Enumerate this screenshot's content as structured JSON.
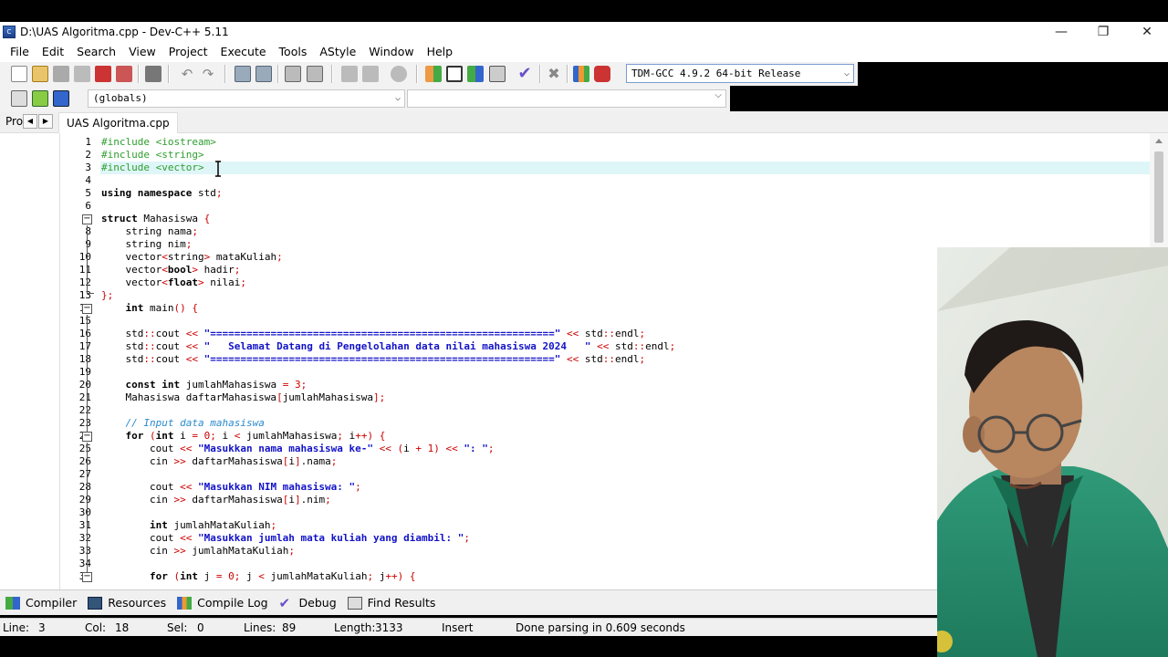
{
  "window": {
    "title": "D:\\UAS Algoritma.cpp - Dev-C++ 5.11",
    "minimize": "—",
    "restore": "❐",
    "close": "✕"
  },
  "menu": [
    "File",
    "Edit",
    "Search",
    "View",
    "Project",
    "Execute",
    "Tools",
    "AStyle",
    "Window",
    "Help"
  ],
  "toolbar": {
    "compiler": "TDM-GCC 4.9.2 64-bit Release",
    "scope": "(globals)",
    "member": ""
  },
  "tabs": {
    "project_tab": "Pro",
    "file_tab": "UAS Algoritma.cpp"
  },
  "editor": {
    "lines": [
      {
        "n": "1",
        "t": "#include <iostream>"
      },
      {
        "n": "2",
        "t": "#include <string>"
      },
      {
        "n": "3",
        "t": "#include <vector>"
      },
      {
        "n": "4",
        "t": ""
      },
      {
        "n": "5",
        "t": "using namespace std;"
      },
      {
        "n": "6",
        "t": ""
      },
      {
        "n": "7",
        "t": "struct Mahasiswa {"
      },
      {
        "n": "8",
        "t": "    string nama;"
      },
      {
        "n": "9",
        "t": "    string nim;"
      },
      {
        "n": "10",
        "t": "    vector<string> mataKuliah;"
      },
      {
        "n": "11",
        "t": "    vector<bool> hadir;"
      },
      {
        "n": "12",
        "t": "    vector<float> nilai;"
      },
      {
        "n": "13",
        "t": "};"
      },
      {
        "n": "14",
        "t": "    int main() {"
      },
      {
        "n": "15",
        "t": ""
      },
      {
        "n": "16",
        "t": "    std::cout << \"=========================================================\" << std::endl;"
      },
      {
        "n": "17",
        "t": "    std::cout << \"   Selamat Datang di Pengelolahan data nilai mahasiswa 2024   \" << std::endl;"
      },
      {
        "n": "18",
        "t": "    std::cout << \"=========================================================\" << std::endl;"
      },
      {
        "n": "19",
        "t": ""
      },
      {
        "n": "20",
        "t": "    const int jumlahMahasiswa = 3;"
      },
      {
        "n": "21",
        "t": "    Mahasiswa daftarMahasiswa[jumlahMahasiswa];"
      },
      {
        "n": "22",
        "t": ""
      },
      {
        "n": "23",
        "t": "    // Input data mahasiswa"
      },
      {
        "n": "24",
        "t": "    for (int i = 0; i < jumlahMahasiswa; i++) {"
      },
      {
        "n": "25",
        "t": "        cout << \"Masukkan nama mahasiswa ke-\" << (i + 1) << \": \";"
      },
      {
        "n": "26",
        "t": "        cin >> daftarMahasiswa[i].nama;"
      },
      {
        "n": "27",
        "t": ""
      },
      {
        "n": "28",
        "t": "        cout << \"Masukkan NIM mahasiswa: \";"
      },
      {
        "n": "29",
        "t": "        cin >> daftarMahasiswa[i].nim;"
      },
      {
        "n": "30",
        "t": ""
      },
      {
        "n": "31",
        "t": "        int jumlahMataKuliah;"
      },
      {
        "n": "32",
        "t": "        cout << \"Masukkan jumlah mata kuliah yang diambil: \";"
      },
      {
        "n": "33",
        "t": "        cin >> jumlahMataKuliah;"
      },
      {
        "n": "34",
        "t": ""
      },
      {
        "n": "35",
        "t": "        for (int j = 0; j < jumlahMataKuliah; j++) {"
      }
    ]
  },
  "bottom_tabs": [
    "Compiler",
    "Resources",
    "Compile Log",
    "Debug",
    "Find Results"
  ],
  "status": {
    "line_label": "Line:",
    "line_value": "3",
    "col_label": "Col:",
    "col_value": "18",
    "sel_label": "Sel:",
    "sel_value": "0",
    "lines_label": "Lines:",
    "lines_value": "89",
    "length_label": "Length:",
    "length_value": "3133",
    "mode": "Insert",
    "message": "Done parsing in 0.609 seconds"
  }
}
